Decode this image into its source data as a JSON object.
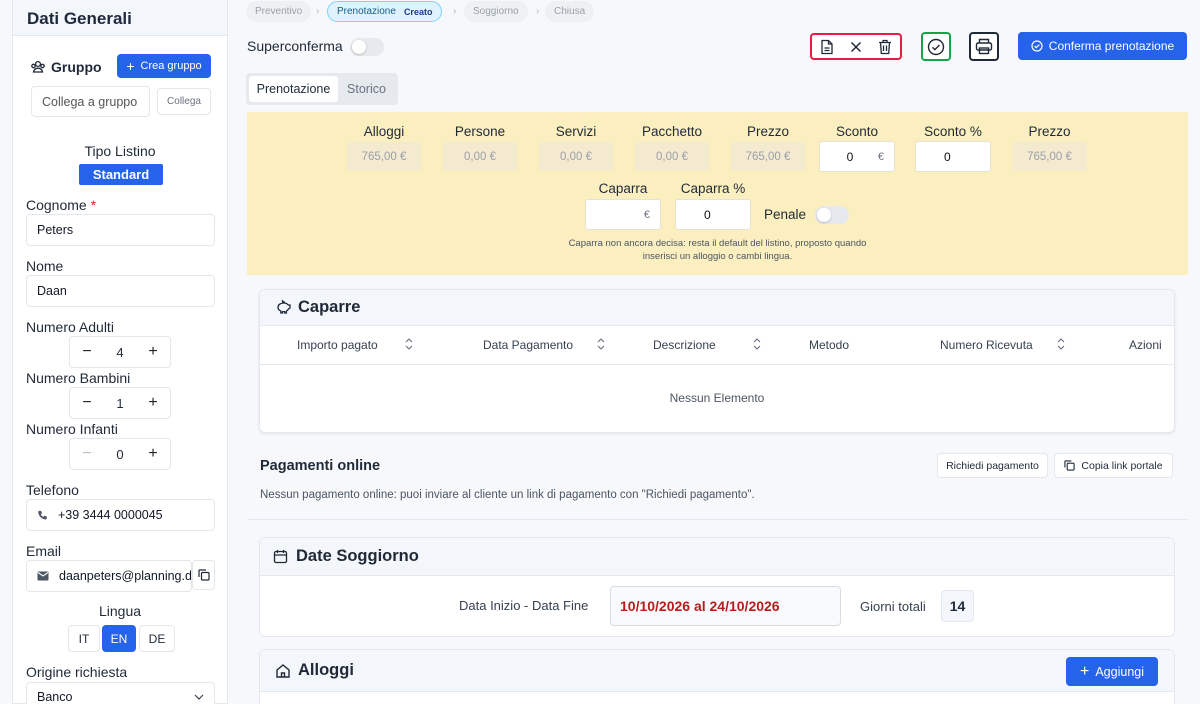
{
  "sidebar": {
    "title": "Dati Generali",
    "group": {
      "label": "Gruppo",
      "create_label": "Crea gruppo",
      "link_placeholder": "Collega a gruppo e",
      "link_button": "Collega"
    },
    "tipo_listino": {
      "label": "Tipo Listino",
      "value": "Standard"
    },
    "cognome": {
      "label": "Cognome",
      "required": "*",
      "value": "Peters"
    },
    "nome": {
      "label": "Nome",
      "value": "Daan"
    },
    "adulti": {
      "label": "Numero Adulti",
      "value": "4"
    },
    "bambini": {
      "label": "Numero Bambini",
      "value": "1"
    },
    "infanti": {
      "label": "Numero Infanti",
      "value": "0"
    },
    "telefono": {
      "label": "Telefono",
      "value": "+39 3444 0000045"
    },
    "email": {
      "label": "Email",
      "value": "daanpeters@planning.d"
    },
    "lingua": {
      "label": "Lingua",
      "options": [
        "IT",
        "EN",
        "DE"
      ],
      "selected": "EN"
    },
    "origine": {
      "label": "Origine richiesta",
      "value": "Banco"
    }
  },
  "breadcrumb": {
    "steps": [
      "Preventivo",
      "Prenotazione",
      "Soggiorno",
      "Chiusa"
    ],
    "active_badge": "Creato"
  },
  "toolbar": {
    "superconferma_label": "Superconferma",
    "confirm_label": "Conferma prenotazione"
  },
  "tabs": [
    "Prenotazione",
    "Storico"
  ],
  "pricing": {
    "alloggi": {
      "label": "Alloggi",
      "value": "765,00 €"
    },
    "persone": {
      "label": "Persone",
      "value": "0,00 €"
    },
    "servizi": {
      "label": "Servizi",
      "value": "0,00 €"
    },
    "pacchetto": {
      "label": "Pacchetto",
      "value": "0,00 €"
    },
    "prezzo": {
      "label": "Prezzo",
      "value": "765,00 €"
    },
    "sconto": {
      "label": "Sconto",
      "value": "0",
      "unit": "€"
    },
    "sconto_pct": {
      "label": "Sconto %",
      "value": "0"
    },
    "prezzo_finale": {
      "label": "Prezzo",
      "value": "765,00 €"
    },
    "caparra": {
      "label": "Caparra",
      "unit": "€"
    },
    "caparra_pct": {
      "label": "Caparra %",
      "value": "0"
    },
    "penale_label": "Penale",
    "note_line1": "Caparra non ancora decisa: resta il default del listino, proposto quando",
    "note_line2": "inserisci un alloggio o cambi lingua."
  },
  "caparre": {
    "title": "Caparre",
    "columns": [
      "Importo pagato",
      "Data Pagamento",
      "Descrizione",
      "Metodo",
      "Numero Ricevuta",
      "Azioni"
    ],
    "empty": "Nessun Elemento"
  },
  "pagamenti": {
    "title": "Pagamenti online",
    "request_button": "Richiedi pagamento",
    "copy_button": "Copia link portale",
    "message": "Nessun pagamento online: puoi inviare al cliente un link di pagamento con \"Richiedi pagamento\"."
  },
  "date_soggiorno": {
    "title": "Date Soggiorno",
    "range_label": "Data Inizio - Data Fine",
    "range_value": "10/10/2026 al 24/10/2026",
    "days_label": "Giorni totali",
    "days_value": "14"
  },
  "alloggi": {
    "title": "Alloggi",
    "add_button": "Aggiungi"
  },
  "colors": {
    "primary": "#2563eb",
    "danger": "#e11d48",
    "success": "#16a34a",
    "panel": "#fcefbf",
    "date_red": "#b91c1c"
  }
}
